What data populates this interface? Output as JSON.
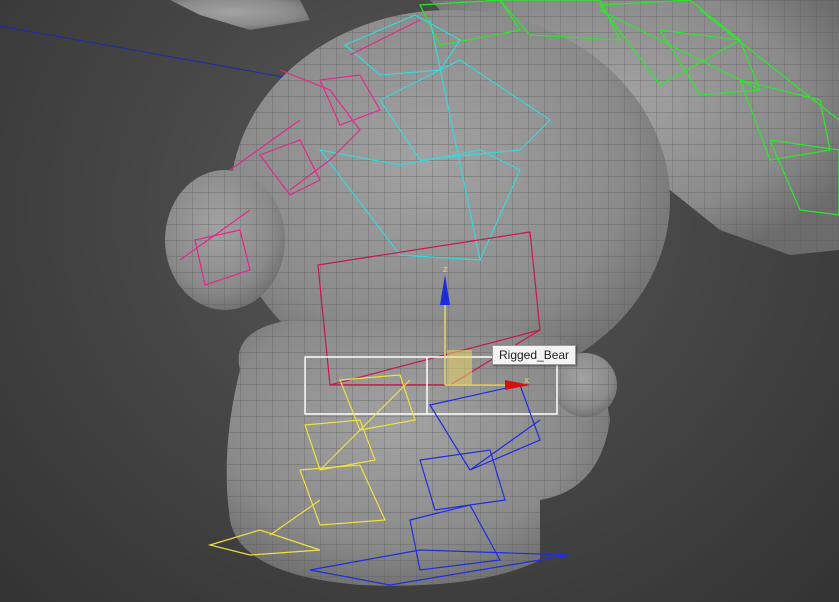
{
  "viewport": {
    "tooltip_label": "Rigged_Bear",
    "gizmo": {
      "z_label": "z",
      "x_label": "x",
      "colors": {
        "z": "#1a2be0",
        "x": "#d41010",
        "plane": "#e8d36a"
      }
    }
  },
  "colors": {
    "background": "#474747",
    "mesh": "#8c8c8c",
    "wire": "#5a5a5a",
    "bone_green": "#2be82b",
    "bone_cyan": "#39d7dc",
    "bone_magenta": "#e2288d",
    "bone_crimson": "#c8184a",
    "bone_yellow": "#f0e040",
    "bone_blue": "#1e2ee0",
    "selection_box": "#ffffff"
  }
}
